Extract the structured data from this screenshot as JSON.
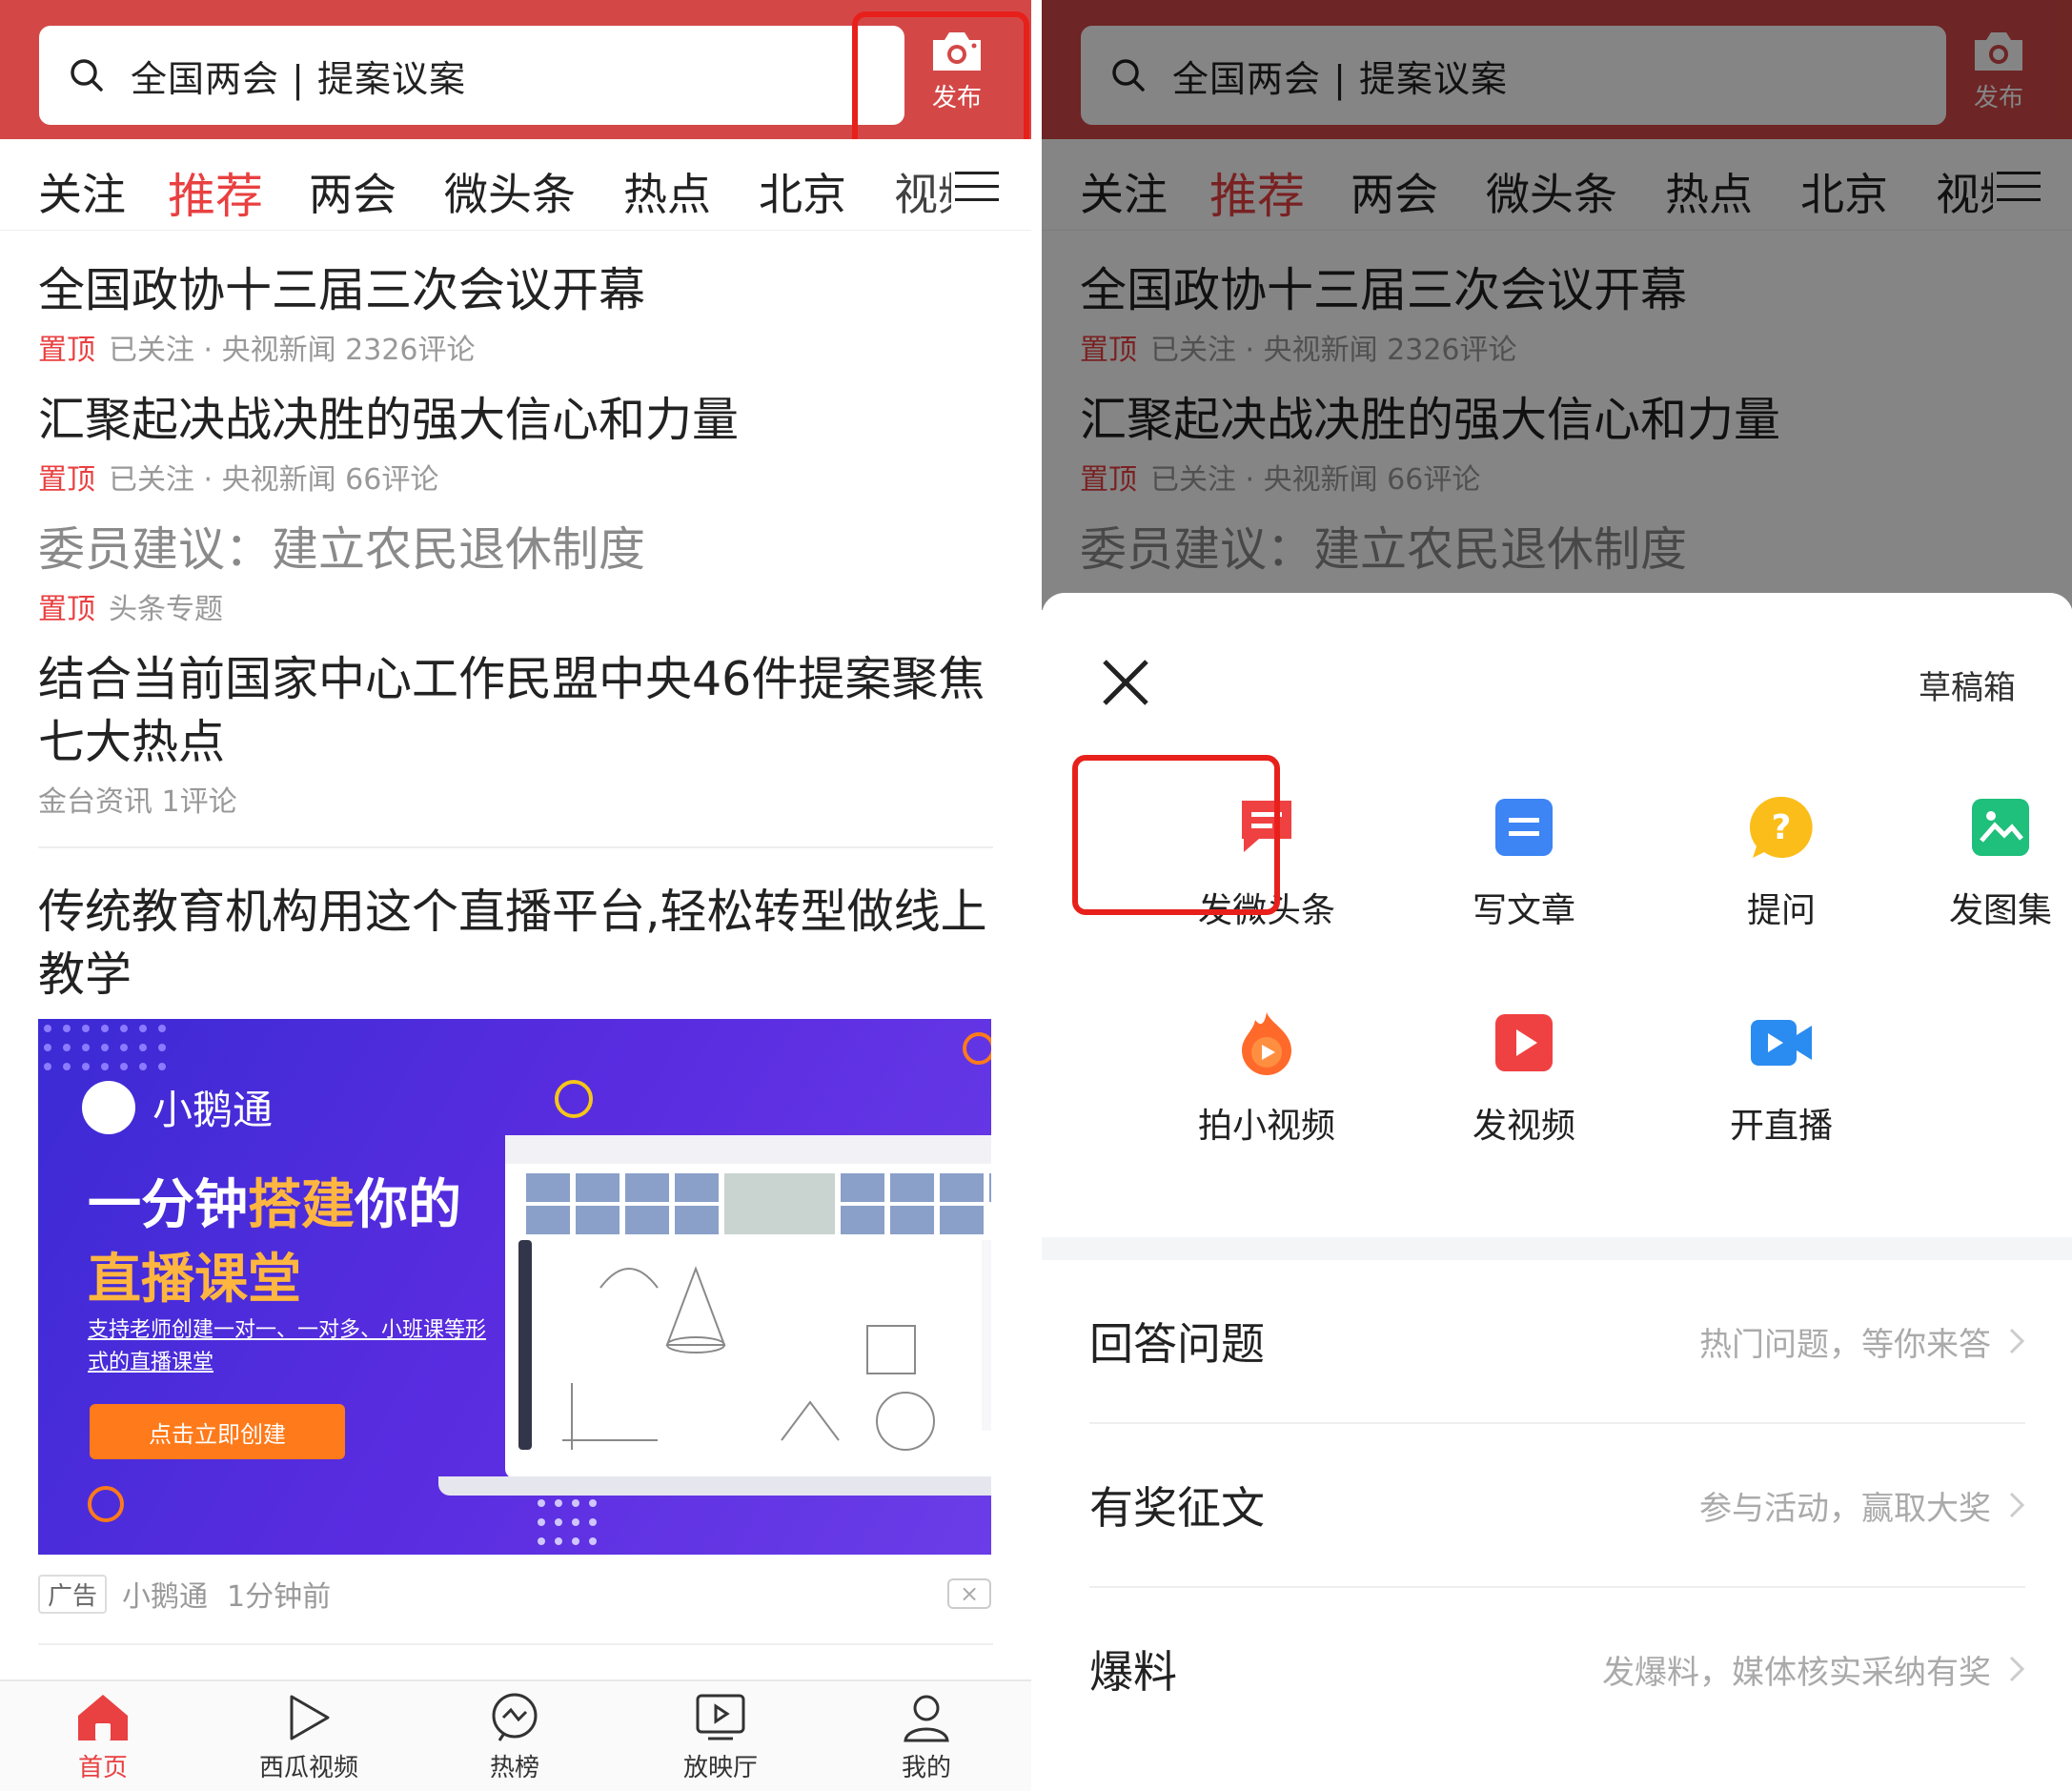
{
  "left": {
    "search": {
      "text": "全国两会 | 提案议案"
    },
    "publish": {
      "label": "发布"
    },
    "tabs": [
      "关注",
      "推荐",
      "两会",
      "微头条",
      "热点",
      "北京",
      "视频"
    ],
    "feed": [
      {
        "title": "全国政协十三届三次会议开幕",
        "pin": "置顶",
        "meta": "已关注 · 央视新闻  2326评论"
      },
      {
        "title": "汇聚起决战决胜的强大信心和力量",
        "pin": "置顶",
        "meta": "已关注 · 央视新闻  66评论"
      },
      {
        "title": "委员建议：建立农民退休制度",
        "pin": "置顶",
        "meta": "头条专题"
      },
      {
        "title": "结合当前国家中心工作民盟中央46件提案聚焦七大热点",
        "meta": "金台资讯  1评论"
      },
      {
        "title": "传统教育机构用这个直播平台,轻松转型做线上教学"
      }
    ],
    "ad": {
      "brand": "小鹅通",
      "headline_a": "一分钟",
      "headline_b": "搭建",
      "headline_c": "你的",
      "headline2": "直播课堂",
      "subtitle": "支持老师创建一对一、一对多、小班课等形式的直播课堂",
      "cta": "点击立即创建",
      "tag": "广告",
      "source": "小鹅通",
      "time": "1分钟前",
      "close": "×"
    },
    "nav": [
      "首页",
      "西瓜视频",
      "热榜",
      "放映厅",
      "我的"
    ]
  },
  "right": {
    "search": {
      "text": "全国两会 | 提案议案"
    },
    "publish": {
      "label": "发布"
    },
    "tabs": [
      "关注",
      "推荐",
      "两会",
      "微头条",
      "热点",
      "北京",
      "视频"
    ],
    "feed": [
      {
        "title": "全国政协十三届三次会议开幕",
        "pin": "置顶",
        "meta": "已关注 · 央视新闻  2326评论"
      },
      {
        "title": "汇聚起决战决胜的强大信心和力量",
        "pin": "置顶",
        "meta": "已关注 · 央视新闻  66评论"
      },
      {
        "title": "委员建议：建立农民退休制度"
      }
    ],
    "sheet": {
      "drafts": "草稿箱",
      "actions": [
        "发微头条",
        "写文章",
        "提问",
        "发图集",
        "拍小视频",
        "发视频",
        "开直播"
      ],
      "rows": [
        {
          "title": "回答问题",
          "hint": "热门问题，等你来答"
        },
        {
          "title": "有奖征文",
          "hint": "参与活动，赢取大奖"
        },
        {
          "title": "爆料",
          "hint": "发爆料，媒体核实采纳有奖"
        }
      ]
    }
  },
  "colors": {
    "header": "#d34847",
    "accent": "#e94041",
    "highlight_box": "#e8201b"
  },
  "icons": [
    "search-icon",
    "camera-icon",
    "menu-icon",
    "home-icon",
    "play-icon",
    "trending-icon",
    "tv-icon",
    "user-icon",
    "close-icon",
    "chat-icon",
    "article-icon",
    "question-icon",
    "image-icon",
    "flame-play-icon",
    "video-icon",
    "live-camera-icon",
    "chevron-right-icon"
  ]
}
